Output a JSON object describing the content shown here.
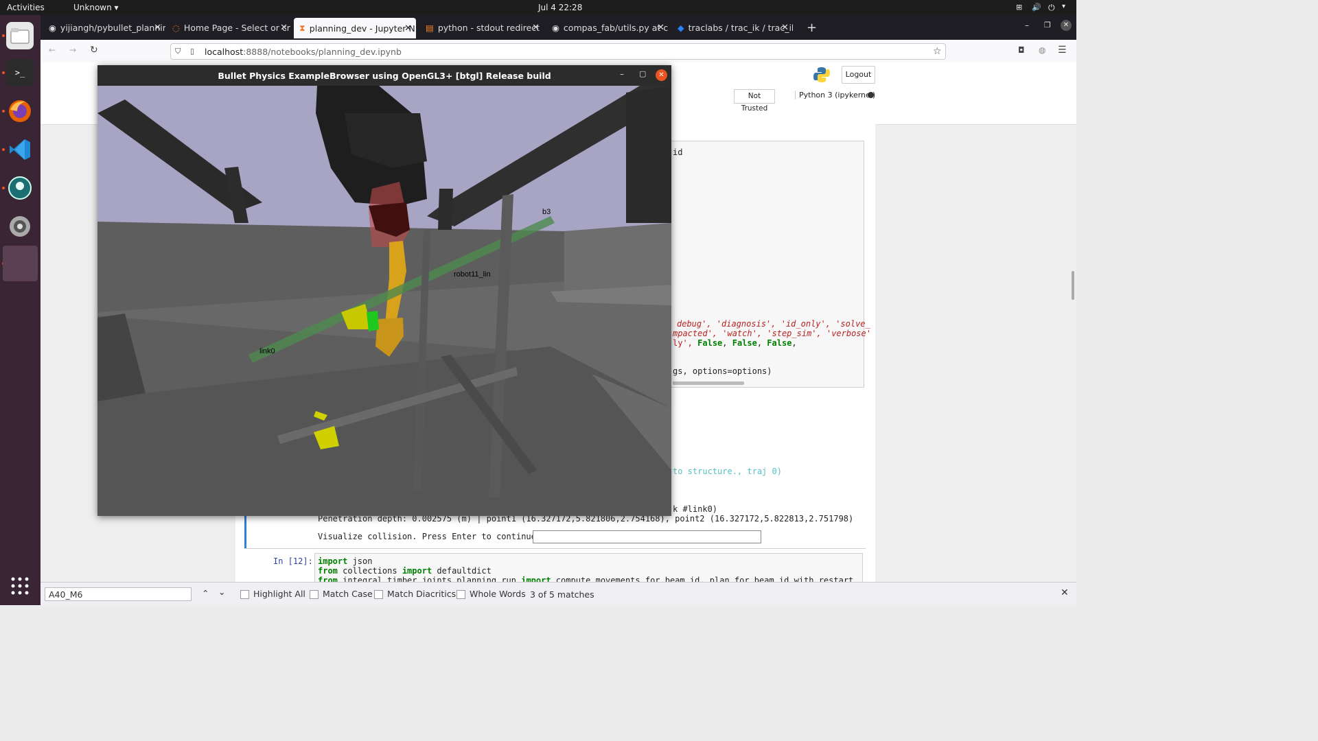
{
  "topbar": {
    "activities": "Activities",
    "app_menu": "Unknown",
    "datetime": "Jul 4  22:28"
  },
  "tabs": [
    {
      "label": "yijiangh/pybullet_plannin",
      "icon": "github-icon"
    },
    {
      "label": "Home Page - Select or cr",
      "icon": "jupyter-icon"
    },
    {
      "label": "planning_dev - Jupyter N",
      "icon": "hourglass-icon"
    },
    {
      "label": "python - stdout redirect",
      "icon": "stackoverflow-icon"
    },
    {
      "label": "compas_fab/utils.py at c",
      "icon": "github-icon"
    },
    {
      "label": "traclabs / trac_ik / trac_ik",
      "icon": "bitbucket-icon"
    }
  ],
  "nav": {
    "url_host": "localhost",
    "url_path": ":8888/notebooks/planning_dev.ipynb"
  },
  "jupyter": {
    "logout": "Logout",
    "trusted": "Not Trusted",
    "kernel": "Python 3 (ipykernel)"
  },
  "notebook": {
    "frag_id": "id",
    "frag_opts1": "debug', 'diagnosis', 'id_only', 'solve_",
    "frag_opts2": "mpacted', 'watch', 'step_sim', 'verbose'",
    "frag_opts3_a": "ly',",
    "frag_false1": "False",
    "frag_false2": "False",
    "frag_false3": "False",
    "frag_call": "gs, options=options)",
    "frag_traj": "to structure., traj 0)",
    "frag_link": "k #link0)",
    "penetration": "Penetration depth: 0.002575 (m) | point1 (16.327172,5.821806,2.754168), point2 (16.327172,5.822813,2.751798)",
    "visualize_prompt": "Visualize collision. Press Enter to continue.",
    "in_prompt": "In [12]:",
    "code_line1_kw": "import",
    "code_line1_rest": " json",
    "code_line2_kw": "from",
    "code_line2_mid": " collections ",
    "code_line2_kw2": "import",
    "code_line2_rest": " defaultdict",
    "code_line3_kw": "from",
    "code_line3_mid": " integral_timber_joints.planning.run ",
    "code_line3_kw2": "import",
    "code_line3_rest": " compute_movements_for_beam_id, plan_for_beam_id_with_restart"
  },
  "bullet_window": {
    "title": "Bullet Physics ExampleBrowser using OpenGL3+ [btgl] Release build",
    "labels": {
      "b3": "b3",
      "robot": "robot11_lin",
      "link0": "link0"
    }
  },
  "findbar": {
    "query": "A40_M6",
    "highlight_all": "Highlight All",
    "match_case": "Match Case",
    "match_diacritics": "Match Diacritics",
    "whole_words": "Whole Words",
    "status": "3 of 5 matches"
  }
}
